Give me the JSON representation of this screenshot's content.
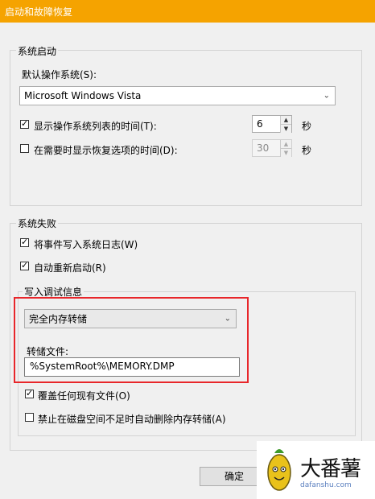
{
  "window": {
    "title": "启动和故障恢复"
  },
  "system_startup": {
    "legend": "系统启动",
    "default_os_label": "默认操作系统(S):",
    "default_os_value": "Microsoft Windows Vista",
    "show_list": {
      "label": "显示操作系统列表的时间(T):",
      "checked": true,
      "value": "6",
      "unit": "秒"
    },
    "show_recovery": {
      "label": "在需要时显示恢复选项的时间(D):",
      "checked": false,
      "value": "30",
      "unit": "秒"
    }
  },
  "system_failure": {
    "legend": "系统失败",
    "write_event": {
      "label": "将事件写入系统日志(W)",
      "checked": true
    },
    "auto_restart": {
      "label": "自动重新启动(R)",
      "checked": true
    },
    "debug_info": {
      "legend": "写入调试信息",
      "dump_type": "完全内存转储",
      "dump_file_label": "转储文件:",
      "dump_file_value": "%SystemRoot%\\MEMORY.DMP",
      "overwrite": {
        "label": "覆盖任何现有文件(O)",
        "checked": true
      },
      "disable_auto_delete": {
        "label": "禁止在磁盘空间不足时自动删除内存转储(A)",
        "checked": false
      }
    }
  },
  "buttons": {
    "ok": "确定"
  },
  "watermark": {
    "text": "大番薯",
    "url": "dafanshu.com",
    "logo": "sweet-potato-mascot-icon"
  },
  "colors": {
    "titlebar": "#f5a300",
    "highlight": "#e8262a"
  }
}
